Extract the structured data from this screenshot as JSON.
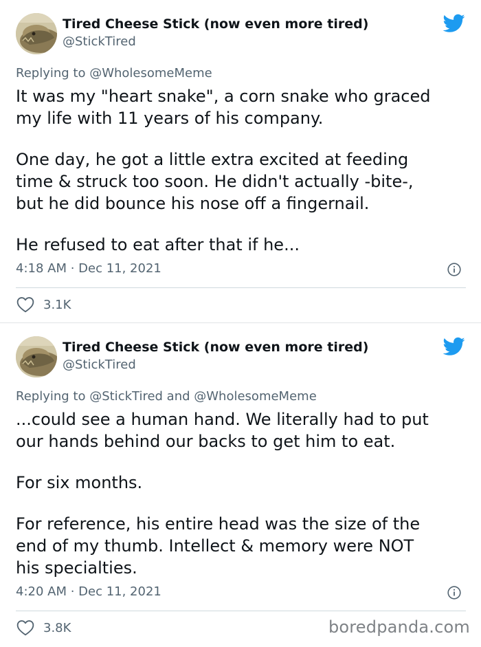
{
  "tweets": [
    {
      "author_name": "Tired Cheese Stick (now even more tired)",
      "author_handle": "@StickTired",
      "replying_to_prefix": "Replying to ",
      "replying_to": "@WholesomeMeme",
      "paragraphs": [
        "It was my \"heart snake\", a corn snake who graced\nmy life with 11 years of his company.",
        "One day, he got a little extra excited at feeding\ntime & struck too soon.  He didn't actually -bite-,\nbut he did bounce his nose off a fingernail.",
        "He refused to eat after that if he..."
      ],
      "timestamp": "4:18 AM · Dec 11, 2021",
      "likes": "3.1K"
    },
    {
      "author_name": "Tired Cheese Stick (now even more tired)",
      "author_handle": "@StickTired",
      "replying_to_prefix": "Replying to ",
      "replying_to": "@StickTired and @WholesomeMeme",
      "paragraphs": [
        "...could see a human hand.  We literally had to put\nour hands behind our backs to get him to eat.",
        "For six months.",
        "For reference, his entire head was the size of the\nend of my thumb.  Intellect & memory were NOT\nhis specialties."
      ],
      "timestamp": "4:20 AM · Dec 11, 2021",
      "likes": "3.8K"
    }
  ],
  "watermark": "boredpanda.com",
  "icons": {
    "brand": "twitter-bird-icon",
    "info": "info-icon",
    "like": "heart-icon",
    "avatar": "bearded-dragon-avatar"
  },
  "colors": {
    "twitter_blue": "#1d9bf0",
    "text_primary": "#0f1419",
    "text_secondary": "#536471",
    "divider": "#cfd9de"
  }
}
